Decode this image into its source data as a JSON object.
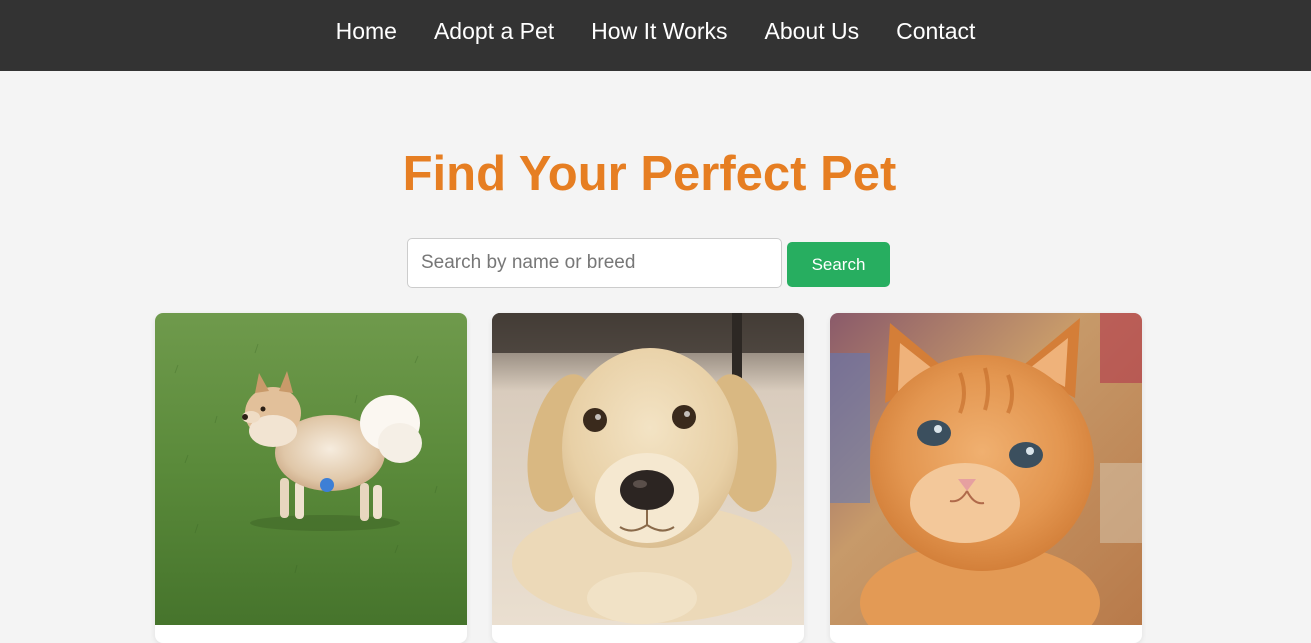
{
  "nav": {
    "items": [
      {
        "label": "Home"
      },
      {
        "label": "Adopt a Pet"
      },
      {
        "label": "How It Works"
      },
      {
        "label": "About Us"
      },
      {
        "label": "Contact"
      }
    ]
  },
  "hero": {
    "title": "Find Your Perfect Pet"
  },
  "search": {
    "placeholder": "Search by name or breed",
    "value": "",
    "button_label": "Search"
  },
  "pets": [
    {
      "photo": "pomeranian-dog-photo"
    },
    {
      "photo": "labrador-puppy-photo"
    },
    {
      "photo": "orange-kitten-photo"
    }
  ],
  "colors": {
    "navbar_bg": "#333333",
    "page_bg": "#f4f4f4",
    "title": "#e67e22",
    "search_button": "#27ae60"
  }
}
